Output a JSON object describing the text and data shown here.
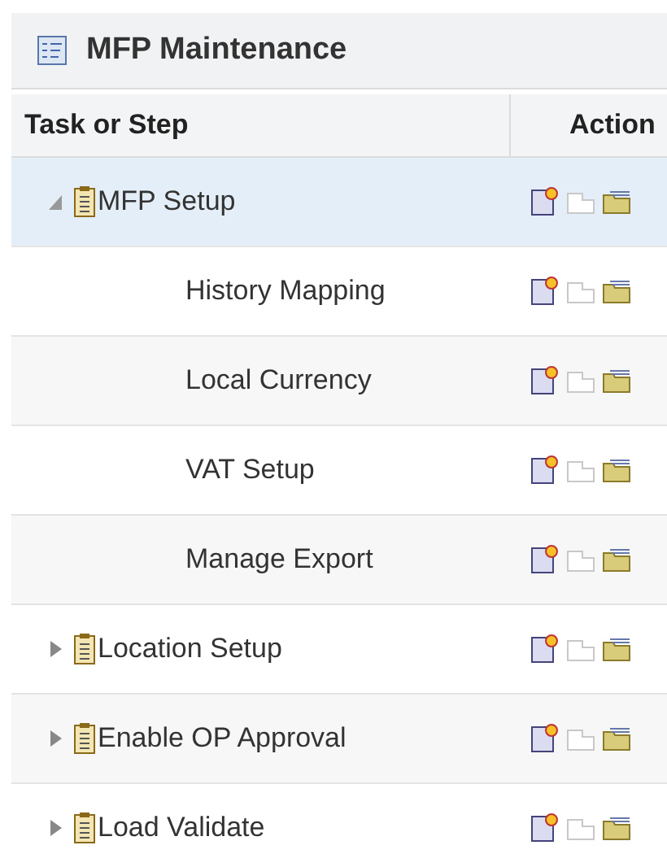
{
  "panel": {
    "title": "MFP Maintenance"
  },
  "table": {
    "columns": [
      "Task or Step",
      "Action"
    ],
    "rows": [
      {
        "label": "MFP Setup",
        "expanded": true,
        "selected": true,
        "children": [
          {
            "label": "History Mapping",
            "selected": false
          },
          {
            "label": "Local Currency",
            "selected": false
          },
          {
            "label": "VAT Setup",
            "selected": false
          },
          {
            "label": "Manage Export",
            "selected": false
          }
        ]
      },
      {
        "label": "Location Setup",
        "expanded": false,
        "selected": false,
        "children": []
      },
      {
        "label": "Enable OP Approval",
        "expanded": false,
        "selected": false,
        "children": []
      },
      {
        "label": "Load Validate",
        "expanded": false,
        "selected": false,
        "children": []
      }
    ]
  }
}
